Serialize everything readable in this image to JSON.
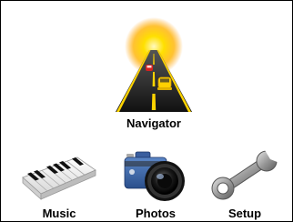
{
  "menu": {
    "items": [
      {
        "label": "Navigator",
        "icon": "road-sun-icon"
      },
      {
        "label": "Music",
        "icon": "piano-keyboard-icon"
      },
      {
        "label": "Photos",
        "icon": "camera-icon"
      },
      {
        "label": "Setup",
        "icon": "wrench-icon"
      }
    ]
  },
  "colors": {
    "background": "#ffffff",
    "border": "#000000",
    "label": "#000000",
    "sun": "#ffcc00",
    "road": "#222222",
    "road_line": "#ffd400"
  }
}
